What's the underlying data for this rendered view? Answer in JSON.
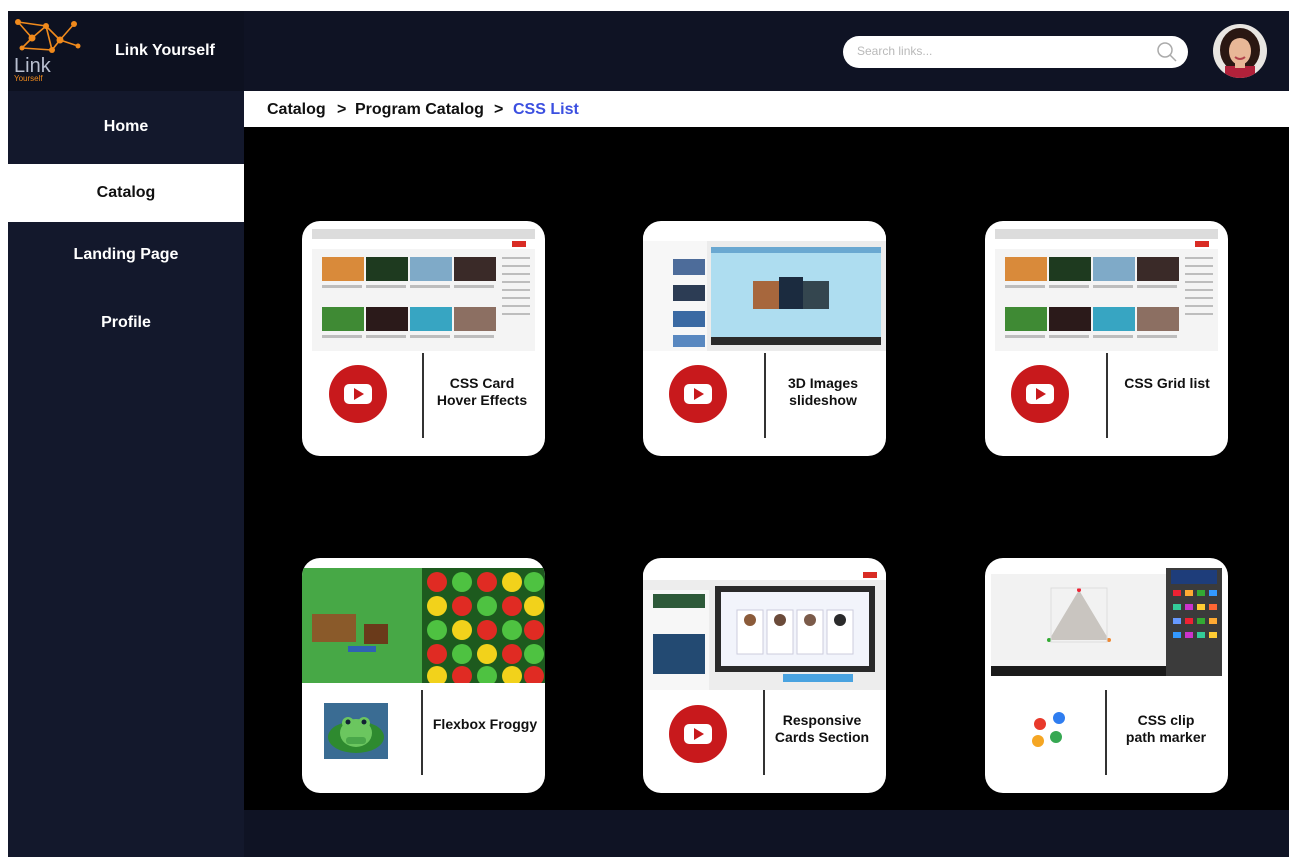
{
  "app": {
    "title": "Link Yourself",
    "logo_line1": "Link",
    "logo_line2": "Yourself"
  },
  "sidebar": {
    "items": [
      {
        "label": "Home",
        "active": false
      },
      {
        "label": "Catalog",
        "active": true
      },
      {
        "label": "Landing Page",
        "active": false
      },
      {
        "label": "Profile",
        "active": false
      }
    ]
  },
  "search": {
    "placeholder": "Search links...",
    "value": ""
  },
  "breadcrumb": {
    "items": [
      "Catalog",
      "Program Catalog"
    ],
    "separator": ">",
    "current": "CSS List"
  },
  "cards": [
    {
      "label_line1": "CSS Card",
      "label_line2": "Hover Effects",
      "icon": "youtube-icon",
      "thumbnail": "youtube-grid"
    },
    {
      "label_line1": "3D Images",
      "label_line2": "slideshow",
      "icon": "youtube-icon",
      "thumbnail": "3d-slideshow"
    },
    {
      "label_line1": "CSS Grid list",
      "label_line2": "",
      "icon": "youtube-icon",
      "thumbnail": "youtube-grid"
    },
    {
      "label_line1": "Flexbox Froggy",
      "label_line2": "",
      "icon": "frog-icon",
      "thumbnail": "flexbox-froggy"
    },
    {
      "label_line1": "Responsive",
      "label_line2": "Cards Section",
      "icon": "youtube-icon",
      "thumbnail": "responsive-cards"
    },
    {
      "label_line1": "CSS clip",
      "label_line2": "path marker",
      "icon": "dots-icon",
      "thumbnail": "clip-path-maker"
    }
  ],
  "colors": {
    "frame": "#0f1324",
    "sidebar": "#13182c",
    "content": "#000000",
    "breadcrumb_current": "#3b4fe0",
    "youtube_red": "#c8191c",
    "logo_orange": "#f08a1c"
  }
}
